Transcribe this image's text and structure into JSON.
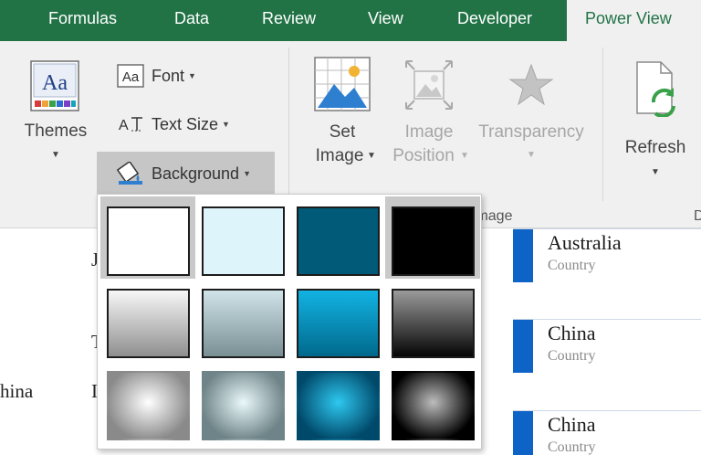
{
  "tabs": [
    {
      "label": "Formulas",
      "active": false
    },
    {
      "label": "Data",
      "active": false
    },
    {
      "label": "Review",
      "active": false
    },
    {
      "label": "View",
      "active": false
    },
    {
      "label": "Developer",
      "active": false
    },
    {
      "label": "Power View",
      "active": true
    }
  ],
  "ribbon": {
    "themes": {
      "label": "Themes",
      "icon": "themes-icon"
    },
    "font": {
      "label": "Font",
      "icon": "font-icon"
    },
    "text_size": {
      "label": "Text Size",
      "icon": "text-size-icon"
    },
    "background": {
      "label": "Background",
      "icon": "background-fill-icon",
      "pressed": true
    },
    "set_image": {
      "line1": "Set",
      "line2": "Image",
      "icon": "set-image-icon"
    },
    "image_position": {
      "line1": "Image",
      "line2": "Position",
      "icon": "image-position-icon",
      "enabled": false
    },
    "transparency": {
      "label": "Transparency",
      "icon": "star-icon",
      "enabled": false
    },
    "refresh": {
      "label": "Refresh",
      "icon": "refresh-icon"
    },
    "image_group_label": "Image",
    "next_group_label": "D"
  },
  "background_gallery": {
    "swatches": [
      {
        "name": "white-solid",
        "style": "solid",
        "colors": [
          "#ffffff"
        ],
        "selected": true
      },
      {
        "name": "light-blue-solid",
        "style": "solid",
        "colors": [
          "#ddf4fa"
        ],
        "selected": false
      },
      {
        "name": "dark-teal-solid",
        "style": "solid",
        "colors": [
          "#005a78"
        ],
        "selected": false
      },
      {
        "name": "black-solid",
        "style": "solid",
        "colors": [
          "#000000"
        ],
        "selected": true
      },
      {
        "name": "gray-gradient",
        "style": "linear",
        "colors": [
          "#f7f7f7",
          "#8f8f8f"
        ],
        "selected": false
      },
      {
        "name": "blue-gray-gradient",
        "style": "linear",
        "colors": [
          "#cfe3e8",
          "#7a8f94"
        ],
        "selected": false
      },
      {
        "name": "cyan-gradient",
        "style": "linear",
        "colors": [
          "#12b3e3",
          "#00698c"
        ],
        "selected": false
      },
      {
        "name": "dark-gradient",
        "style": "linear",
        "colors": [
          "#9a9a9a",
          "#050505"
        ],
        "selected": false
      },
      {
        "name": "gray-radial",
        "style": "radial",
        "colors": [
          "#ffffff",
          "#8a8a8a"
        ],
        "selected": false
      },
      {
        "name": "blue-gray-radial",
        "style": "radial",
        "colors": [
          "#e9f8fb",
          "#6f8488"
        ],
        "selected": false
      },
      {
        "name": "cyan-radial",
        "style": "radial",
        "colors": [
          "#2ec8f0",
          "#00496a"
        ],
        "selected": false
      },
      {
        "name": "dark-radial",
        "style": "radial",
        "colors": [
          "#bdbdbd",
          "#000000"
        ],
        "selected": false
      }
    ]
  },
  "sheet": {
    "left_fragments": [
      "J",
      "T",
      "hina",
      "I"
    ]
  },
  "cards": [
    {
      "title": "Australia",
      "subtitle": "Country"
    },
    {
      "title": "China",
      "subtitle": "Country"
    },
    {
      "title": "China",
      "subtitle": "Country"
    }
  ],
  "colors": {
    "excel_green": "#217346",
    "ribbon_bg": "#f0f0f0",
    "card_accent": "#0e63c7"
  }
}
